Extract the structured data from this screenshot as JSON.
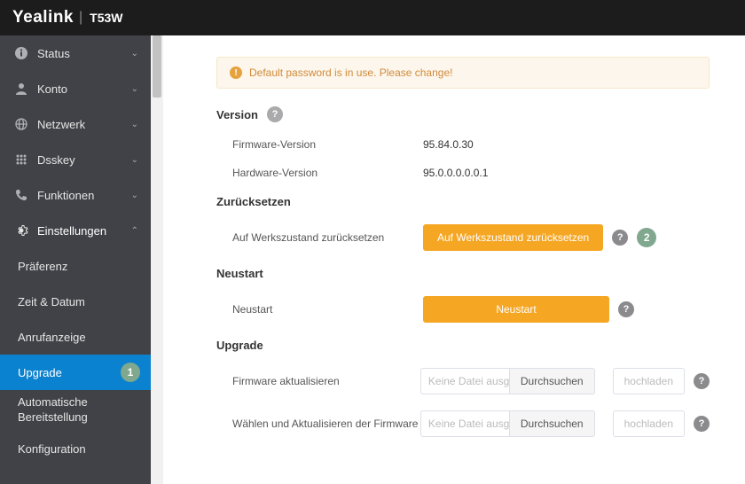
{
  "header": {
    "brand": "Yealink",
    "model": "T53W"
  },
  "sidebar": {
    "items": [
      {
        "label": "Status",
        "icon": "info"
      },
      {
        "label": "Konto",
        "icon": "user"
      },
      {
        "label": "Netzwerk",
        "icon": "globe"
      },
      {
        "label": "Dsskey",
        "icon": "grid"
      },
      {
        "label": "Funktionen",
        "icon": "phone"
      },
      {
        "label": "Einstellungen",
        "icon": "gear",
        "expanded": true
      }
    ],
    "subitems": [
      {
        "label": "Präferenz"
      },
      {
        "label": "Zeit & Datum"
      },
      {
        "label": "Anrufanzeige"
      },
      {
        "label": "Upgrade",
        "active": true,
        "badge": "1"
      },
      {
        "label": "Automatische Bereitstellung"
      },
      {
        "label": "Konfiguration"
      }
    ]
  },
  "alert": {
    "text": "Default password is in use. Please change!"
  },
  "sections": {
    "version": {
      "title": "Version",
      "firmware_label": "Firmware-Version",
      "firmware_value": "95.84.0.30",
      "hardware_label": "Hardware-Version",
      "hardware_value": "95.0.0.0.0.0.1"
    },
    "reset": {
      "title": "Zurücksetzen",
      "factory_label": "Auf Werkszustand zurücksetzen",
      "factory_button": "Auf Werkszustand zurücksetzen",
      "badge": "2"
    },
    "restart": {
      "title": "Neustart",
      "restart_label": "Neustart",
      "restart_button": "Neustart"
    },
    "upgrade": {
      "title": "Upgrade",
      "firmware_update_label": "Firmware aktualisieren",
      "select_update_label": "Wählen und Aktualisieren der Firmware de…",
      "no_file": "Keine Datei ausg",
      "browse": "Durchsuchen",
      "upload": "hochladen"
    }
  }
}
